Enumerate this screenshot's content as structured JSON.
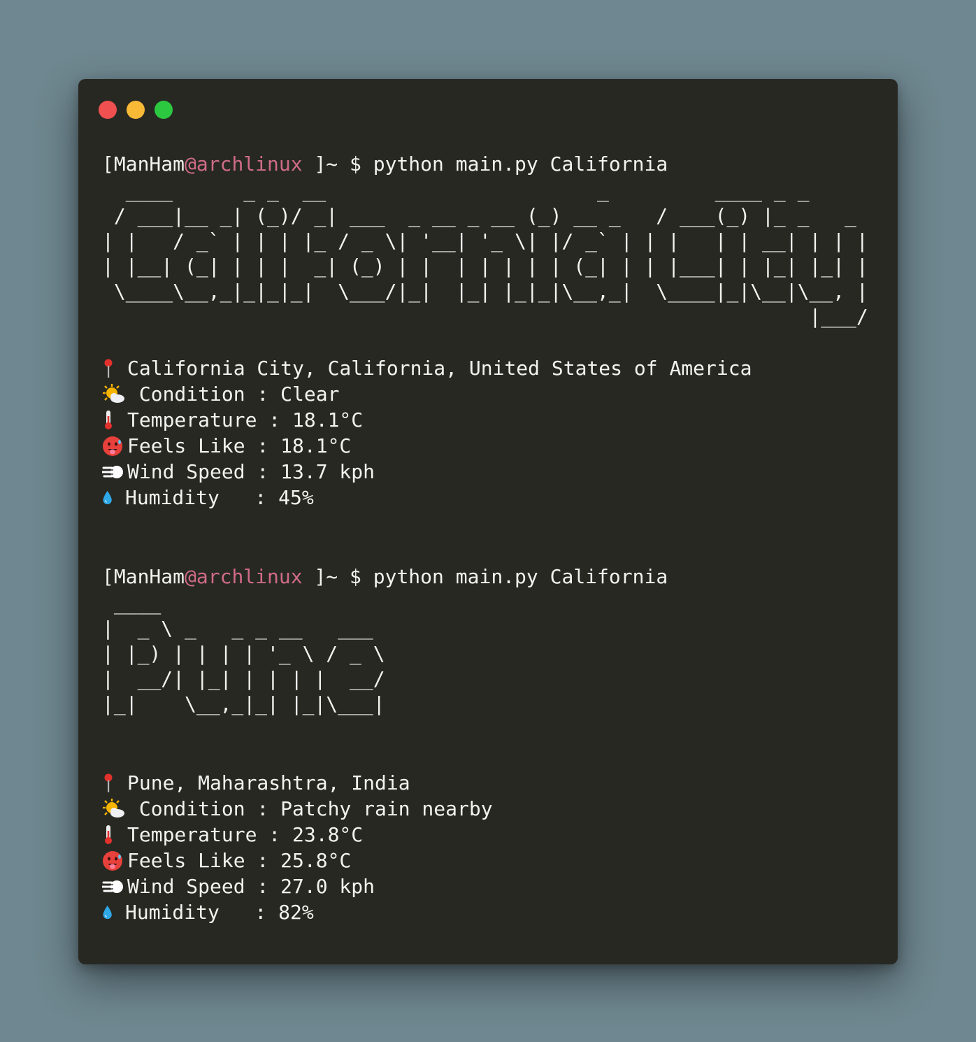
{
  "window": {
    "buttons": {
      "close_color": "#f0504f",
      "minimize_color": "#f8b937",
      "maximize_color": "#2bc840"
    }
  },
  "sessions": [
    {
      "prompt": {
        "user": "[ManHam",
        "host": "@archlinux",
        "rest": " ]~ $ python main.py California"
      },
      "banner": "  ____      _ _  __                       _         ____ _ _\n / ___|__ _| (_)/ _| ___  _ __ _ __ (_) __ _   / ___(_) |_ _   _\n| |   / _` | | | |_ / _ \\| '__| '_ \\| |/ _` | | |   | | __| | | |\n| |__| (_| | | |  _| (_) | |  | | | | | (_| | | |___| | |_| |_| |\n \\____\\__,_|_|_|_|  \\___/|_|  |_| |_|_|\\__,_|  \\____|_|\\__|\\__, |\n                                                            |___/",
      "location": "California City, California, United States of America",
      "condition": " Condition : Clear",
      "temperature": "Temperature : 18.1°C",
      "feels_like": "Feels Like : 18.1°C",
      "wind": "Wind Speed : 13.7 kph",
      "humidity": "Humidity   : 45%"
    },
    {
      "prompt": {
        "user": "[ManHam",
        "host": "@archlinux",
        "rest": " ]~ $ python main.py California"
      },
      "banner": " ____\n|  _ \\ _   _ _ __   ___\n| |_) | | | | '_ \\ / _ \\\n|  __/| |_| | | | |  __/\n|_|    \\__,_|_| |_|\\___|",
      "location": "Pune, Maharashtra, India",
      "condition": " Condition : Patchy rain nearby",
      "temperature": "Temperature : 23.8°C",
      "feels_like": "Feels Like : 25.8°C",
      "wind": "Wind Speed : 27.0 kph",
      "humidity": "Humidity   : 82%"
    }
  ],
  "icons": [
    "round-pushpin-icon",
    "sun-behind-cloud-icon",
    "thermometer-icon",
    "hot-face-icon",
    "dashing-away-icon",
    "droplet-icon"
  ]
}
